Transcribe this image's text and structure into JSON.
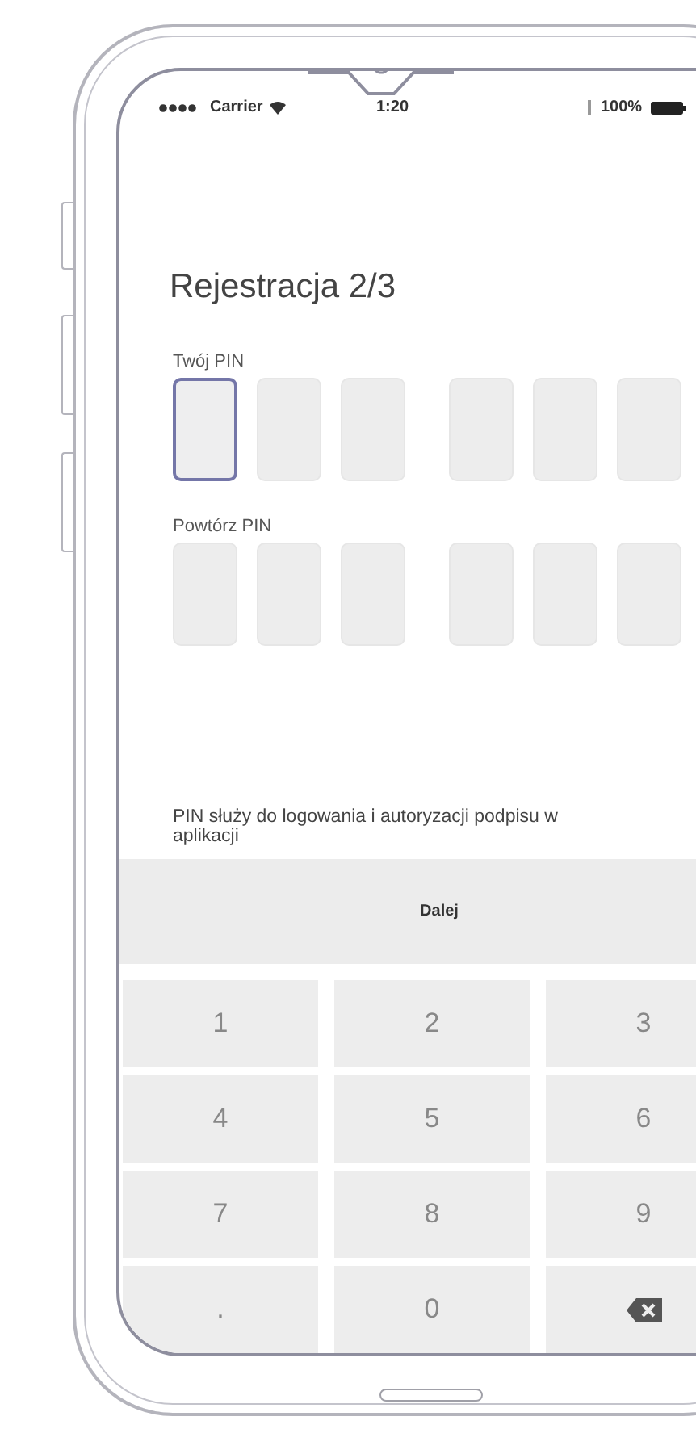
{
  "status_bar": {
    "carrier": "Carrier",
    "time": "1:20",
    "battery": "100%"
  },
  "title": "Rejestracja 2/3",
  "pin_fields": [
    {
      "label": "Twój PIN",
      "boxes": [
        {
          "selected": true
        },
        {
          "selected": false
        },
        {
          "selected": false
        },
        {
          "selected": false
        },
        {
          "selected": false
        },
        {
          "selected": false
        }
      ]
    },
    {
      "label": "Powtórz PIN",
      "boxes": [
        {
          "selected": false
        },
        {
          "selected": false
        },
        {
          "selected": false
        },
        {
          "selected": false
        },
        {
          "selected": false
        },
        {
          "selected": false
        }
      ]
    }
  ],
  "hint": "PIN służy do logowania i autoryzacji podpisu w aplikacji",
  "next_button": "Dalej",
  "keypad": [
    {
      "kind": "digit",
      "label": "1"
    },
    {
      "kind": "digit",
      "label": "2"
    },
    {
      "kind": "digit",
      "label": "3"
    },
    {
      "kind": "digit",
      "label": "4"
    },
    {
      "kind": "digit",
      "label": "5"
    },
    {
      "kind": "digit",
      "label": "6"
    },
    {
      "kind": "digit",
      "label": "7"
    },
    {
      "kind": "digit",
      "label": "8"
    },
    {
      "kind": "digit",
      "label": "9"
    },
    {
      "kind": "digit",
      "label": "."
    },
    {
      "kind": "digit",
      "label": "0"
    },
    {
      "kind": "backspace"
    }
  ]
}
